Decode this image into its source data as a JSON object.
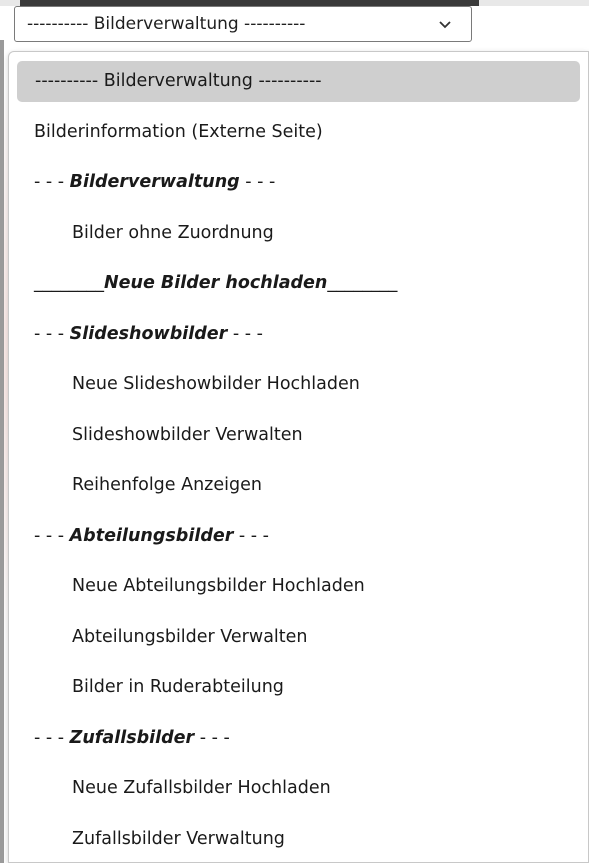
{
  "select": {
    "value": "---------- Bilderverwaltung ----------"
  },
  "options": [
    {
      "label": "---------- Bilderverwaltung ----------",
      "kind": "selected"
    },
    {
      "label": "Bilderinformation (Externe Seite)",
      "kind": "plain"
    },
    {
      "prefix": "- - - ",
      "label": "Bilderverwaltung",
      "suffix": " - - -",
      "kind": "group"
    },
    {
      "label": "Bilder ohne Zuordnung",
      "kind": "indent"
    },
    {
      "prefix": "________",
      "label": "Neue Bilder hochladen",
      "suffix": "________",
      "kind": "group"
    },
    {
      "prefix": "- - - ",
      "label": "Slideshowbilder",
      "suffix": " - - -",
      "kind": "group"
    },
    {
      "label": "Neue Slideshowbilder Hochladen",
      "kind": "indent"
    },
    {
      "label": "Slideshowbilder Verwalten",
      "kind": "indent"
    },
    {
      "label": "Reihenfolge Anzeigen",
      "kind": "indent"
    },
    {
      "prefix": "- - - ",
      "label": "Abteilungsbilder",
      "suffix": " - - -",
      "kind": "group"
    },
    {
      "label": "Neue Abteilungsbilder Hochladen",
      "kind": "indent"
    },
    {
      "label": "Abteilungsbilder Verwalten",
      "kind": "indent"
    },
    {
      "label": "Bilder in Ruderabteilung",
      "kind": "indent"
    },
    {
      "prefix": "- - - ",
      "label": "Zufallsbilder",
      "suffix": " - - -",
      "kind": "group"
    },
    {
      "label": "Neue Zufallsbilder Hochladen",
      "kind": "indent"
    },
    {
      "label": "Zufallsbilder Verwaltung",
      "kind": "indent"
    }
  ],
  "icons": {
    "select_arrow": "chevron-down-icon"
  }
}
